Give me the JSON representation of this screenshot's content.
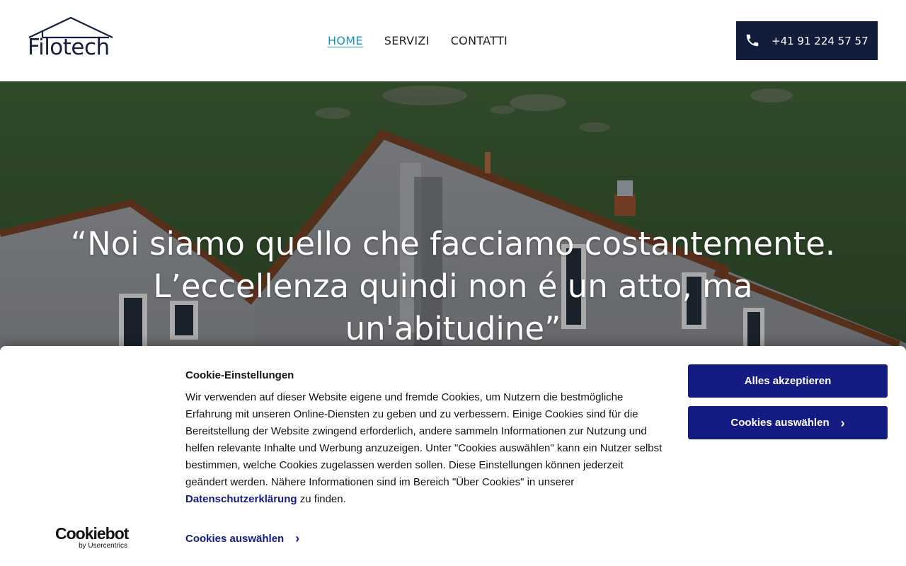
{
  "header": {
    "logo_text": "Filotech",
    "nav": [
      {
        "label": "HOME",
        "active": true
      },
      {
        "label": "SERVIZI",
        "active": false
      },
      {
        "label": "CONTATTI",
        "active": false
      }
    ],
    "phone": "+41 91 224 57 57",
    "phone_icon": "phone-icon",
    "colors": {
      "navy": "#121c3b",
      "active_link": "#1a8fc4"
    }
  },
  "hero": {
    "quote_line1": "“Noi siamo quello che facciamo costantemente.",
    "quote_line2": "L’eccellenza quindi non é un atto, ma",
    "quote_line3": "un'abitudine”"
  },
  "cookie_banner": {
    "title": "Cookie-Einstellungen",
    "body_text": "Wir verwenden auf dieser Website eigene und fremde Cookies, um Nutzern die bestmögliche Erfahrung mit unseren Online-Diensten zu geben und zu verbessern. Einige Cookies sind für die Bereitstellung der Website zwingend erforderlich, andere sammeln Informationen zur Nutzung und helfen relevante Inhalte und Werbung anzuzeigen. Unter \"Cookies auswählen\" kann ein Nutzer selbst bestimmen, welche Cookies zugelassen werden sollen. Diese Einstellungen können jederzeit geändert werden. Nähere Informationen sind im Bereich \"Über Cookies\" in unserer",
    "privacy_link": "Datenschutzerklärung",
    "body_suffix": " zu finden.",
    "accept_all": "Alles akzeptieren",
    "select_cookies": "Cookies auswählen",
    "select_cookies_link": "Cookies auswählen",
    "brand": "Cookiebot",
    "brand_sub": "by Usercentrics",
    "colors": {
      "button": "#141b82"
    }
  }
}
